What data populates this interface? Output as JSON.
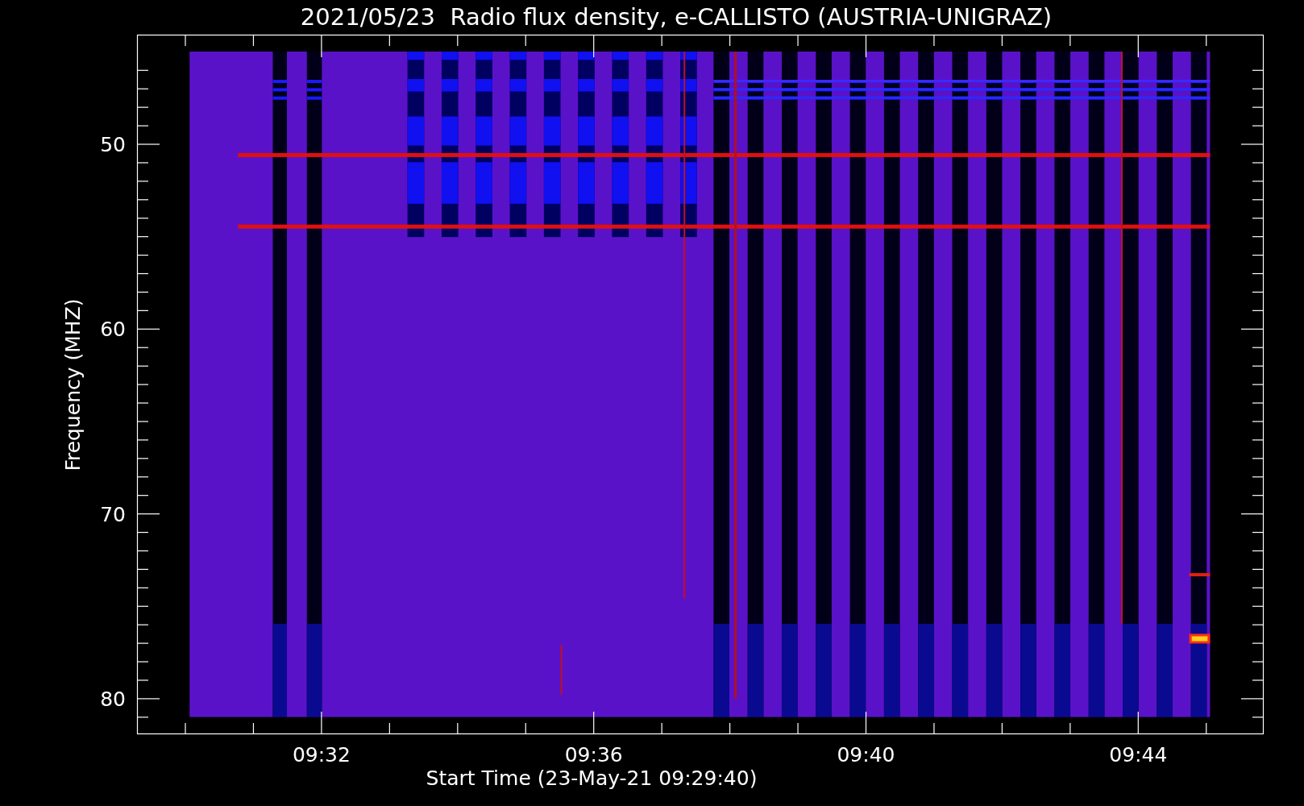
{
  "title": "2021/05/23  Radio flux density, e-CALLISTO (AUSTRIA-UNIGRAZ)",
  "y_axis": {
    "label": "Frequency (MHZ)",
    "tick_labels": [
      "50",
      "60",
      "70",
      "80"
    ]
  },
  "x_axis": {
    "label": "Start Time (23-May-21 09:29:40)",
    "tick_labels": [
      "09:32",
      "09:36",
      "09:40",
      "09:44"
    ]
  }
}
